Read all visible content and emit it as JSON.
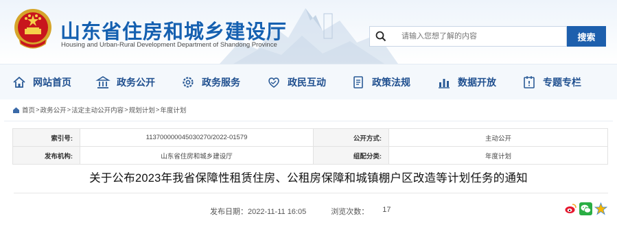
{
  "header": {
    "site_title": "山东省住房和城乡建设厅",
    "site_subtitle": "Housing and Urban-Rural Development Department of Shandong Province",
    "search": {
      "placeholder": "请输入您想了解的内容",
      "button_label": "搜索"
    }
  },
  "nav": {
    "items": [
      {
        "label": "网站首页",
        "icon": "home-icon"
      },
      {
        "label": "政务公开",
        "icon": "building-icon"
      },
      {
        "label": "政务服务",
        "icon": "gear-icon"
      },
      {
        "label": "政民互动",
        "icon": "handshake-icon"
      },
      {
        "label": "政策法规",
        "icon": "document-icon"
      },
      {
        "label": "数据开放",
        "icon": "bar-chart-icon"
      },
      {
        "label": "专题专栏",
        "icon": "special-topic-icon"
      }
    ]
  },
  "breadcrumb": {
    "items": [
      "首页",
      "政务公开",
      "法定主动公开内容",
      "规划计划",
      "年度计划"
    ],
    "separator": ">"
  },
  "meta": {
    "index_label": "索引号:",
    "index_value": "113700000045030270/2022-01579",
    "open_type_label": "公开方式:",
    "open_type_value": "主动公开",
    "publisher_label": "发布机构:",
    "publisher_value": "山东省住房和城乡建设厅",
    "category_label": "组配分类:",
    "category_value": "年度计划"
  },
  "article": {
    "title": "关于公布2023年我省保障性租赁住房、公租房保障和城镇棚户区改造等计划任务的通知",
    "publish_date": "发布日期：2022-11-11 16:05",
    "views_label": "浏览次数：",
    "views_count": "17"
  },
  "share": {
    "icons": [
      "weibo-icon",
      "wechat-icon",
      "qzone-icon"
    ]
  },
  "colors": {
    "brand_blue": "#1560b0",
    "nav_text": "#1f4f8f",
    "search_button": "#1d5fad"
  }
}
